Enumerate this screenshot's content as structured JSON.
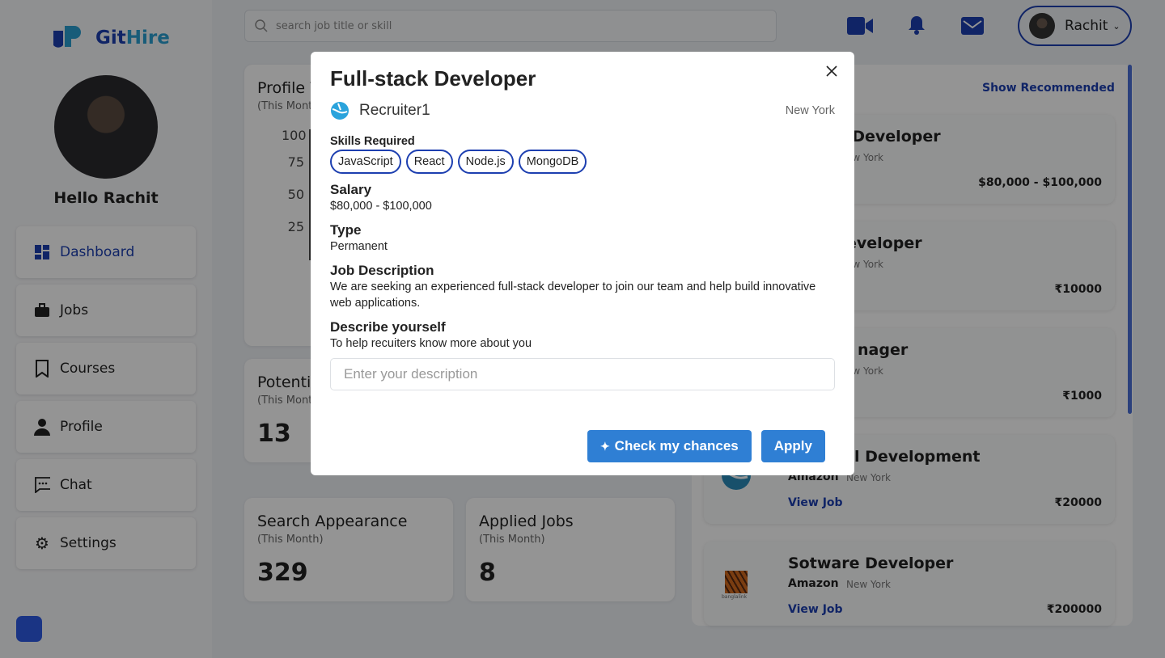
{
  "app": {
    "name_part1": "Git",
    "name_part2": "Hire",
    "greeting": "Hello Rachit",
    "user": "Rachit"
  },
  "search": {
    "placeholder": "search job title or skill"
  },
  "sidebar": {
    "items": [
      {
        "label": "Dashboard",
        "icon": "dashboard-icon"
      },
      {
        "label": "Jobs",
        "icon": "briefcase-icon"
      },
      {
        "label": "Courses",
        "icon": "bookmark-icon"
      },
      {
        "label": "Profile",
        "icon": "person-icon"
      },
      {
        "label": "Chat",
        "icon": "chat-icon"
      },
      {
        "label": "Settings",
        "icon": "gear-icon"
      }
    ]
  },
  "stats": {
    "profile_views": {
      "title": "Profile V",
      "sub": "(This Mont",
      "ticks": [
        "100",
        "75",
        "50",
        "25"
      ]
    },
    "potential": {
      "title": "Potentic",
      "sub": "(This Mont",
      "value": "13"
    },
    "search_appearance": {
      "title": "Search Appearance",
      "sub": "(This Month)",
      "value": "329"
    },
    "applied_jobs": {
      "title": "Applied Jobs",
      "sub": "(This Month)",
      "value": "8"
    }
  },
  "jobs": {
    "show_recommended": "Show Recommended",
    "view_job": "View Job",
    "items": [
      {
        "title": "k Developer",
        "location": "ew York",
        "salary": "$80,000 - $100,000"
      },
      {
        "title": "eveloper",
        "location": "ew York",
        "salary": "₹10000"
      },
      {
        "title": "nager",
        "location": "ew York",
        "salary": "₹1000"
      },
      {
        "title": "l Development",
        "company": "Amazon",
        "location": "New York",
        "salary": "₹20000"
      },
      {
        "title": "Sotware Developer",
        "company": "Amazon",
        "location": "New York",
        "salary": "₹200000",
        "logo_text": "banglalink"
      }
    ]
  },
  "modal": {
    "title": "Full-stack Developer",
    "recruiter": "Recruiter1",
    "location": "New York",
    "skills_label": "Skills Required",
    "skills": [
      "JavaScript",
      "React",
      "Node.js",
      "MongoDB"
    ],
    "salary_label": "Salary",
    "salary": "$80,000 - $100,000",
    "type_label": "Type",
    "type": "Permanent",
    "desc_label": "Job Description",
    "desc": "We are seeking an experienced full-stack developer to join our team and help build innovative web applications.",
    "describe_label": "Describe yourself",
    "describe_hint": "To help recuiters know more about you",
    "describe_placeholder": "Enter your description",
    "check_label": "Check my chances",
    "apply_label": "Apply"
  },
  "colors": {
    "brand": "#1d3fb0",
    "accent": "#2f7fd4"
  }
}
